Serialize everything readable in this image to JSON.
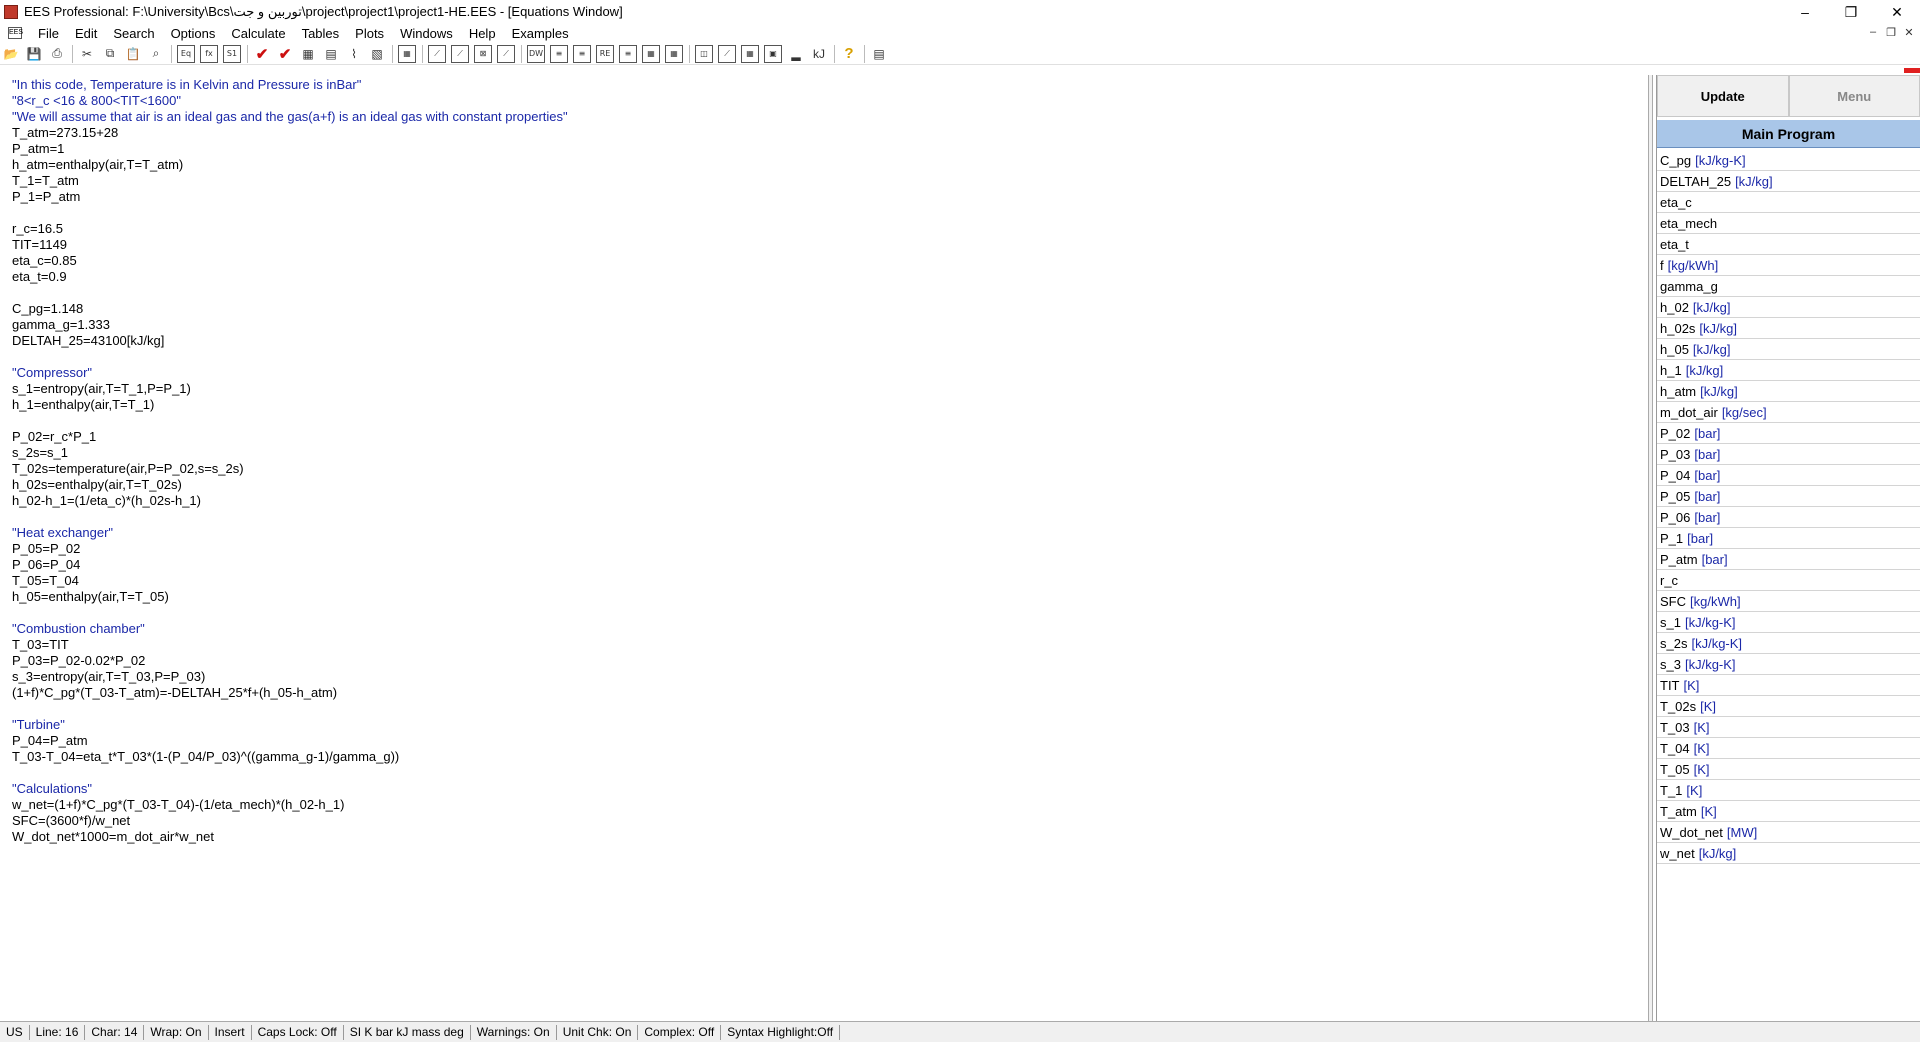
{
  "window": {
    "title": "EES Professional:  F:\\University\\Bcs\\توربین و جت\\project\\project1\\project1-HE.EES - [Equations Window]",
    "controls": [
      "–",
      "❐",
      "✕"
    ]
  },
  "menu": [
    "File",
    "Edit",
    "Search",
    "Options",
    "Calculate",
    "Tables",
    "Plots",
    "Windows",
    "Help",
    "Examples"
  ],
  "equations": [
    {
      "text": "\"In this code, Temperature is in Kelvin and Pressure is inBar\"",
      "type": "comment"
    },
    {
      "text": "\"8<r_c <16 & 800<TIT<1600\"",
      "type": "comment"
    },
    {
      "text": "\"We will assume that air is an ideal gas and the gas(a+f) is an ideal gas with constant properties\"",
      "type": "comment"
    },
    {
      "text": "T_atm=273.15+28",
      "type": "code"
    },
    {
      "text": "P_atm=1",
      "type": "code"
    },
    {
      "text": "h_atm=enthalpy(air,T=T_atm)",
      "type": "code"
    },
    {
      "text": "T_1=T_atm",
      "type": "code"
    },
    {
      "text": "P_1=P_atm",
      "type": "code"
    },
    {
      "text": "",
      "type": "code"
    },
    {
      "text": "r_c=16.5",
      "type": "code"
    },
    {
      "text": "TIT=1149",
      "type": "code"
    },
    {
      "text": "eta_c=0.85",
      "type": "code"
    },
    {
      "text": "eta_t=0.9",
      "type": "code"
    },
    {
      "text": "",
      "type": "code"
    },
    {
      "text": "C_pg=1.148",
      "type": "code"
    },
    {
      "text": "gamma_g=1.333",
      "type": "code"
    },
    {
      "text": "DELTAH_25=43100[kJ/kg]",
      "type": "code"
    },
    {
      "text": "",
      "type": "code"
    },
    {
      "text": "\"Compressor\"",
      "type": "comment"
    },
    {
      "text": "s_1=entropy(air,T=T_1,P=P_1)",
      "type": "code"
    },
    {
      "text": "h_1=enthalpy(air,T=T_1)",
      "type": "code"
    },
    {
      "text": "",
      "type": "code"
    },
    {
      "text": "P_02=r_c*P_1",
      "type": "code"
    },
    {
      "text": "s_2s=s_1",
      "type": "code"
    },
    {
      "text": "T_02s=temperature(air,P=P_02,s=s_2s)",
      "type": "code"
    },
    {
      "text": "h_02s=enthalpy(air,T=T_02s)",
      "type": "code"
    },
    {
      "text": "h_02-h_1=(1/eta_c)*(h_02s-h_1)",
      "type": "code"
    },
    {
      "text": "",
      "type": "code"
    },
    {
      "text": "\"Heat exchanger\"",
      "type": "comment"
    },
    {
      "text": "P_05=P_02",
      "type": "code"
    },
    {
      "text": "P_06=P_04",
      "type": "code"
    },
    {
      "text": "T_05=T_04",
      "type": "code"
    },
    {
      "text": "h_05=enthalpy(air,T=T_05)",
      "type": "code"
    },
    {
      "text": "",
      "type": "code"
    },
    {
      "text": "\"Combustion chamber\"",
      "type": "comment"
    },
    {
      "text": "T_03=TIT",
      "type": "code"
    },
    {
      "text": "P_03=P_02-0.02*P_02",
      "type": "code"
    },
    {
      "text": "s_3=entropy(air,T=T_03,P=P_03)",
      "type": "code"
    },
    {
      "text": "(1+f)*C_pg*(T_03-T_atm)=-DELTAH_25*f+(h_05-h_atm)",
      "type": "code"
    },
    {
      "text": "",
      "type": "code"
    },
    {
      "text": "\"Turbine\"",
      "type": "comment"
    },
    {
      "text": "P_04=P_atm",
      "type": "code"
    },
    {
      "text": "T_03-T_04=eta_t*T_03*(1-(P_04/P_03)^((gamma_g-1)/gamma_g))",
      "type": "code"
    },
    {
      "text": "",
      "type": "code"
    },
    {
      "text": "\"Calculations\"",
      "type": "comment"
    },
    {
      "text": "w_net=(1+f)*C_pg*(T_03-T_04)-(1/eta_mech)*(h_02-h_1)",
      "type": "code"
    },
    {
      "text": "SFC=(3600*f)/w_net",
      "type": "code"
    },
    {
      "text": "W_dot_net*1000=m_dot_air*w_net",
      "type": "code"
    }
  ],
  "panel": {
    "update_label": "Update",
    "menu_label": "Menu",
    "header": "Main Program",
    "variables": [
      {
        "name": "C_pg",
        "unit": "[kJ/kg-K]"
      },
      {
        "name": "DELTAH_25",
        "unit": "[kJ/kg]"
      },
      {
        "name": "eta_c",
        "unit": ""
      },
      {
        "name": "eta_mech",
        "unit": ""
      },
      {
        "name": "eta_t",
        "unit": ""
      },
      {
        "name": "f",
        "unit": "[kg/kWh]"
      },
      {
        "name": "gamma_g",
        "unit": ""
      },
      {
        "name": "h_02",
        "unit": "[kJ/kg]"
      },
      {
        "name": "h_02s",
        "unit": "[kJ/kg]"
      },
      {
        "name": "h_05",
        "unit": "[kJ/kg]"
      },
      {
        "name": "h_1",
        "unit": "[kJ/kg]"
      },
      {
        "name": "h_atm",
        "unit": "[kJ/kg]"
      },
      {
        "name": "m_dot_air",
        "unit": "[kg/sec]"
      },
      {
        "name": "P_02",
        "unit": "[bar]"
      },
      {
        "name": "P_03",
        "unit": "[bar]"
      },
      {
        "name": "P_04",
        "unit": "[bar]"
      },
      {
        "name": "P_05",
        "unit": "[bar]"
      },
      {
        "name": "P_06",
        "unit": "[bar]"
      },
      {
        "name": "P_1",
        "unit": "[bar]"
      },
      {
        "name": "P_atm",
        "unit": "[bar]"
      },
      {
        "name": "r_c",
        "unit": ""
      },
      {
        "name": "SFC",
        "unit": "[kg/kWh]"
      },
      {
        "name": "s_1",
        "unit": "[kJ/kg-K]"
      },
      {
        "name": "s_2s",
        "unit": "[kJ/kg-K]"
      },
      {
        "name": "s_3",
        "unit": "[kJ/kg-K]"
      },
      {
        "name": "TIT",
        "unit": "[K]"
      },
      {
        "name": "T_02s",
        "unit": "[K]"
      },
      {
        "name": "T_03",
        "unit": "[K]"
      },
      {
        "name": "T_04",
        "unit": "[K]"
      },
      {
        "name": "T_05",
        "unit": "[K]"
      },
      {
        "name": "T_1",
        "unit": "[K]"
      },
      {
        "name": "T_atm",
        "unit": "[K]"
      },
      {
        "name": "W_dot_net",
        "unit": "[MW]"
      },
      {
        "name": "w_net",
        "unit": "[kJ/kg]"
      }
    ]
  },
  "status": [
    {
      "name": "keyboard-layout",
      "text": "US"
    },
    {
      "name": "line",
      "text": "Line: 16"
    },
    {
      "name": "char",
      "text": "Char: 14"
    },
    {
      "name": "wrap",
      "text": "Wrap: On"
    },
    {
      "name": "insert-mode",
      "text": "Insert"
    },
    {
      "name": "caps-lock",
      "text": "Caps Lock: Off"
    },
    {
      "name": "unit-system",
      "text": "SI K bar kJ mass deg"
    },
    {
      "name": "warnings",
      "text": "Warnings: On"
    },
    {
      "name": "unit-check",
      "text": "Unit Chk: On"
    },
    {
      "name": "complex",
      "text": "Complex: Off"
    },
    {
      "name": "syntax-highlight",
      "text": "Syntax Highlight:Off"
    }
  ],
  "colors": {
    "comment": "#1b28a8",
    "unit": "#1b28a8",
    "panel_header": "#a9c6e8"
  }
}
